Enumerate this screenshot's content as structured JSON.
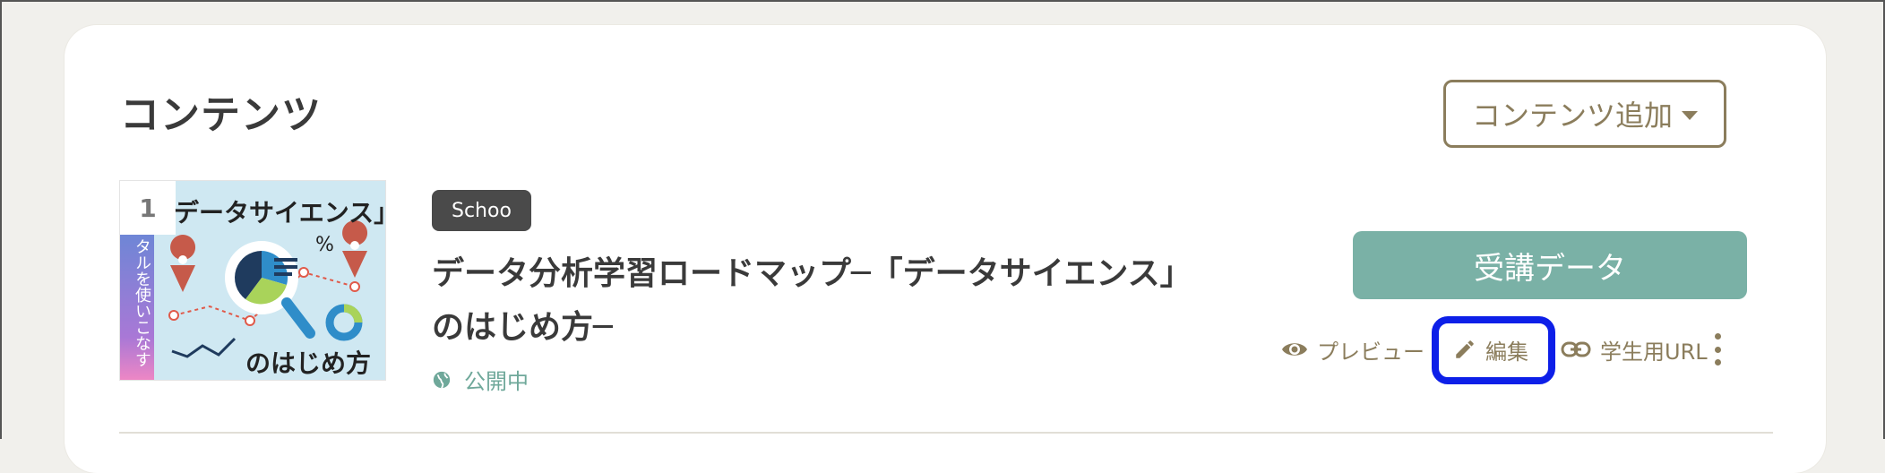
{
  "section": {
    "title": "コンテンツ",
    "add_button": "コンテンツ追加"
  },
  "content_item": {
    "thumbnail": {
      "number": "1",
      "top_text": "データサイエンス」",
      "side_text": "タルを使いこなす",
      "bottom_text": "のはじめ方"
    },
    "badge": "Schoo",
    "title_line1": "データ分析学習ロードマップ─「データサイエンス」",
    "title_line2": "のはじめ方─",
    "status": "公開中",
    "attend_button": "受講データ",
    "actions": {
      "preview": "プレビュー",
      "edit": "編集",
      "student_url": "学生用URL"
    }
  },
  "colors": {
    "accent": "#8b7d5c",
    "teal": "#7ab1a6",
    "status_green": "#6fa89a",
    "highlight": "#0d1fe8"
  }
}
